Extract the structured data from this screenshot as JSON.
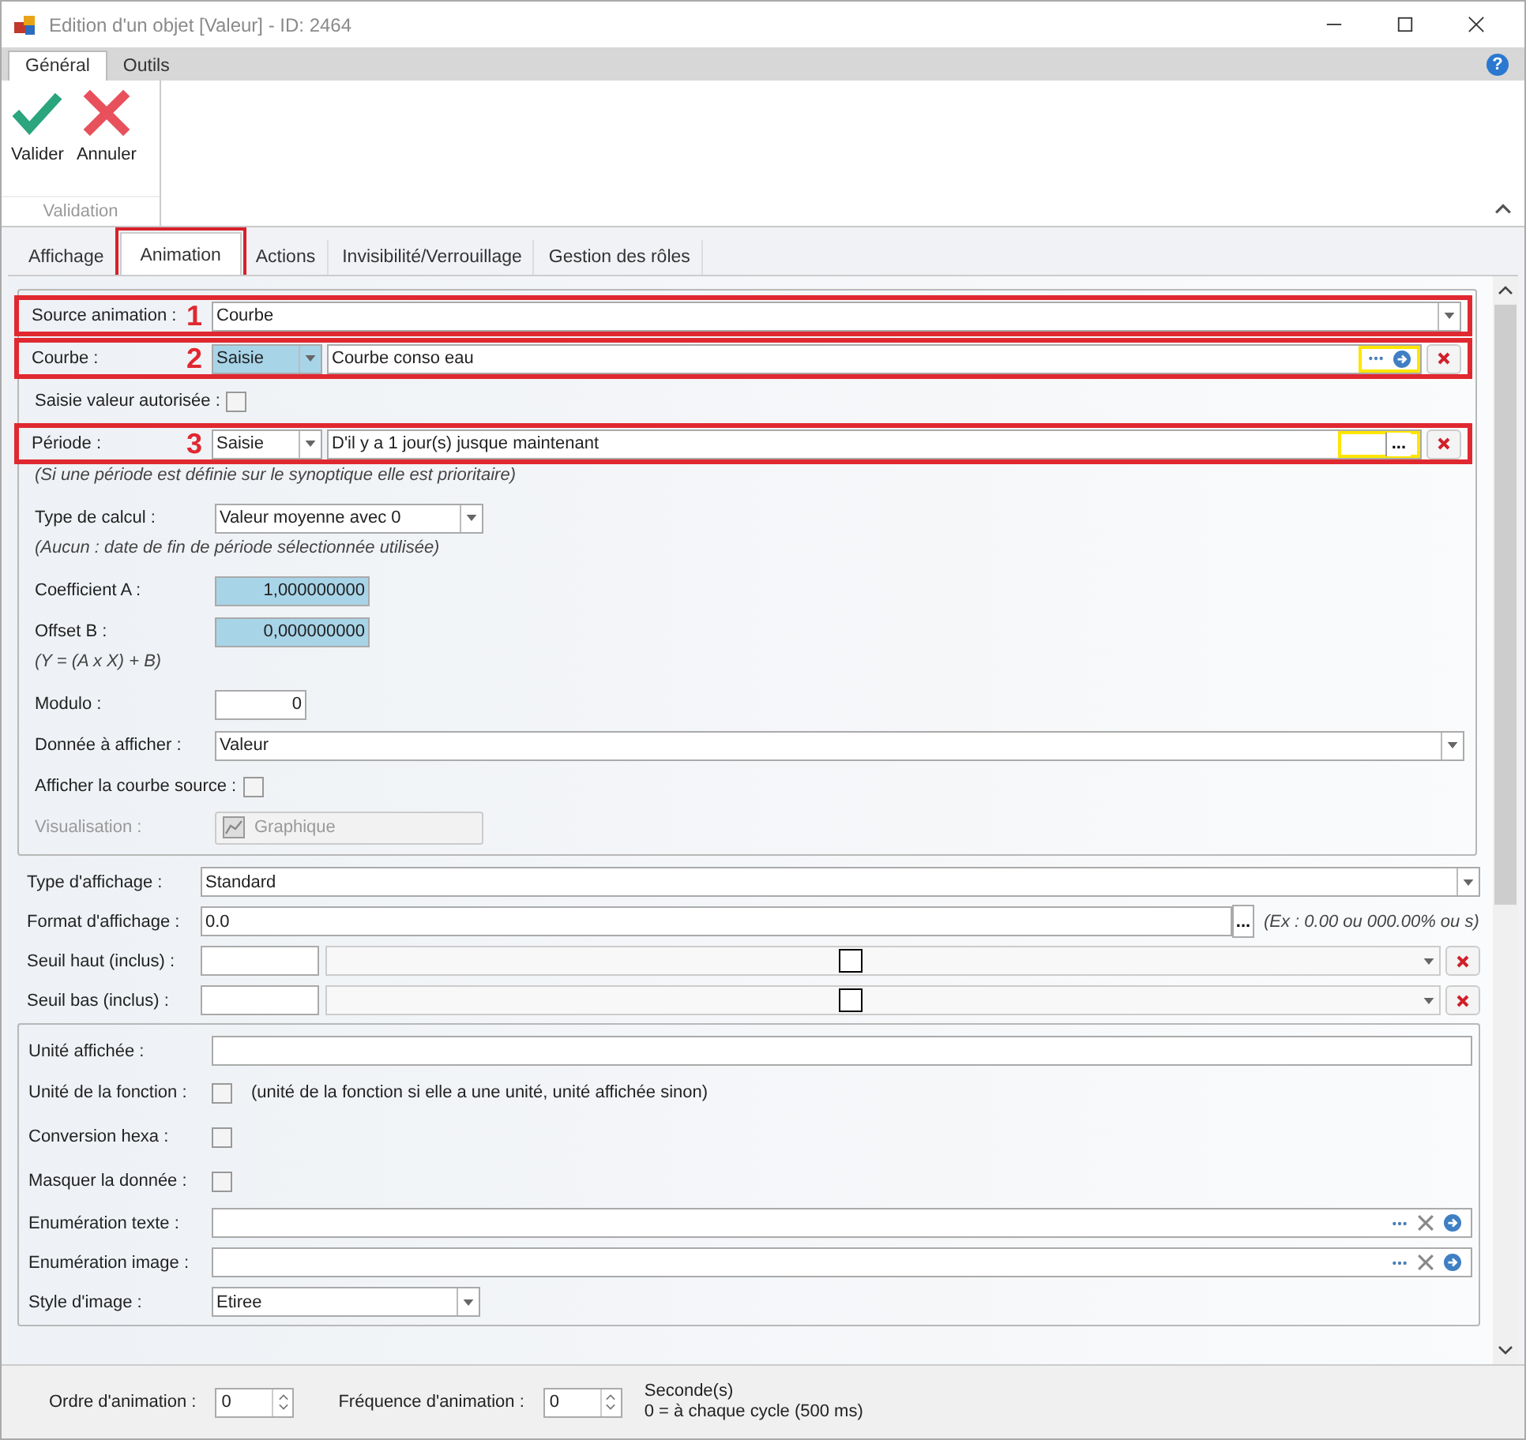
{
  "window": {
    "title": "Edition d'un objet [Valeur] - ID: 2464"
  },
  "ribbon": {
    "tabs": [
      {
        "label": "Général",
        "selected": true
      },
      {
        "label": "Outils",
        "selected": false
      }
    ],
    "help_label": "?",
    "buttons": [
      {
        "label": "Valider",
        "kind": "check"
      },
      {
        "label": "Annuler",
        "kind": "cross"
      }
    ],
    "group_label": "Validation"
  },
  "tabs": [
    {
      "label": "Affichage",
      "selected": false,
      "outlined": false
    },
    {
      "label": "Animation",
      "selected": true,
      "outlined": true
    },
    {
      "label": "Actions",
      "selected": false,
      "outlined": false
    },
    {
      "label": "Invisibilité/Verrouillage",
      "selected": false,
      "outlined": false
    },
    {
      "label": "Gestion des rôles",
      "selected": false,
      "outlined": false
    }
  ],
  "animation_group": [
    {
      "kind": "combo",
      "label": "Source animation :",
      "value": "Courbe",
      "annotation": "1"
    },
    {
      "kind": "mode",
      "label": "Courbe :",
      "mode": "Saisie",
      "focused": true,
      "value": "Courbe conso eau",
      "annotation": "2",
      "tools": {
        "kind": "link"
      },
      "marked": true
    },
    {
      "kind": "checkbox",
      "label": "Saisie valeur autorisée :",
      "checked": false
    },
    {
      "kind": "mode",
      "label": "Période :",
      "mode": "Saisie",
      "focused": false,
      "value": "D'il y a 1 jour(s) jusque maintenant",
      "annotation": "3",
      "tools": {
        "kind": "browse",
        "label": "..."
      },
      "marked": true
    },
    {
      "kind": "note",
      "text": "(Si une période est définie sur le synoptique elle est prioritaire)"
    },
    {
      "kind": "short_combo",
      "label": "Type de calcul :",
      "value": "Valeur moyenne avec 0"
    },
    {
      "kind": "note",
      "text": "(Aucun : date de fin de période sélectionnée utilisée)"
    },
    {
      "kind": "number",
      "label": "Coefficient A :",
      "value": "1,000000000",
      "highlighted": true
    },
    {
      "kind": "number",
      "label": "Offset B :",
      "value": "0,000000000",
      "highlighted": true
    },
    {
      "kind": "note",
      "text": "(Y = (A x X) + B)"
    },
    {
      "kind": "small_number",
      "label": "Modulo :",
      "value": "0",
      "highlighted": false
    },
    {
      "kind": "combo",
      "label": "Donnée à afficher :",
      "value": "Valeur"
    },
    {
      "kind": "checkbox",
      "label": "Afficher la courbe source :",
      "checked": false
    },
    {
      "kind": "button",
      "label": "Visualisation :",
      "button": "Graphique",
      "disabled": true
    }
  ],
  "display_rows": [
    {
      "kind": "combo",
      "label": "Type d'affichage :",
      "value": "Standard"
    },
    {
      "kind": "format",
      "label": "Format d'affichage :",
      "value": "0.0",
      "browse_label": "...",
      "hint": "(Ex : 0.00 ou 000.00% ou s)"
    },
    {
      "kind": "threshold",
      "label": "Seuil haut (inclus) :"
    },
    {
      "kind": "threshold",
      "label": "Seuil bas (inclus) :"
    }
  ],
  "unit_group": [
    {
      "kind": "text",
      "label": "Unité affichée :"
    },
    {
      "kind": "checkbox",
      "label": "Unité de la fonction :",
      "checked": false,
      "note": "(unité de la fonction si elle a une unité, unité affichée sinon)"
    },
    {
      "kind": "checkbox",
      "label": "Conversion hexa :",
      "checked": false
    },
    {
      "kind": "checkbox",
      "label": "Masquer la donnée :",
      "checked": false
    },
    {
      "kind": "enum",
      "label": "Enumération texte :"
    },
    {
      "kind": "enum",
      "label": "Enumération image :"
    },
    {
      "kind": "short_combo",
      "label": "Style d'image :",
      "value": "Etiree"
    }
  ],
  "footer": {
    "order_label": "Ordre d'animation :",
    "order_value": "0",
    "frequency_label": "Fréquence d'animation :",
    "frequency_value": "0",
    "unit": "Seconde(s)",
    "unit_note": "0 = à chaque cycle (500 ms)"
  }
}
